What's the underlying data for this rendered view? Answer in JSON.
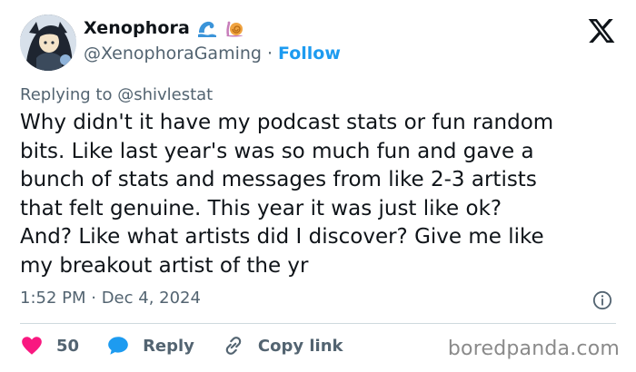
{
  "author": {
    "display_name": "Xenophora",
    "emojis": [
      "wave-emoji",
      "snail-emoji"
    ],
    "handle": "@XenophoraGaming",
    "separator": "·",
    "follow_label": "Follow"
  },
  "reply_to": "Replying to @shivlestat",
  "tweet": {
    "lines": [
      "Why didn't it have my podcast stats or fun random",
      "bits. Like last year's was so much fun and gave a",
      "bunch of stats and messages from like 2-3 artists",
      "that felt genuine. This year it was just like ok?",
      "And? Like what artists did I discover? Give me like",
      "my breakout artist of the yr"
    ]
  },
  "timestamp": "1:52 PM · Dec 4, 2024",
  "actions": {
    "like_count": "50",
    "reply_label": "Reply",
    "copy_link_label": "Copy link"
  },
  "watermark": "boredpanda.com",
  "colors": {
    "accent": "#1d9bf0",
    "like": "#f91880",
    "muted": "#536471",
    "text": "#0f1419"
  }
}
